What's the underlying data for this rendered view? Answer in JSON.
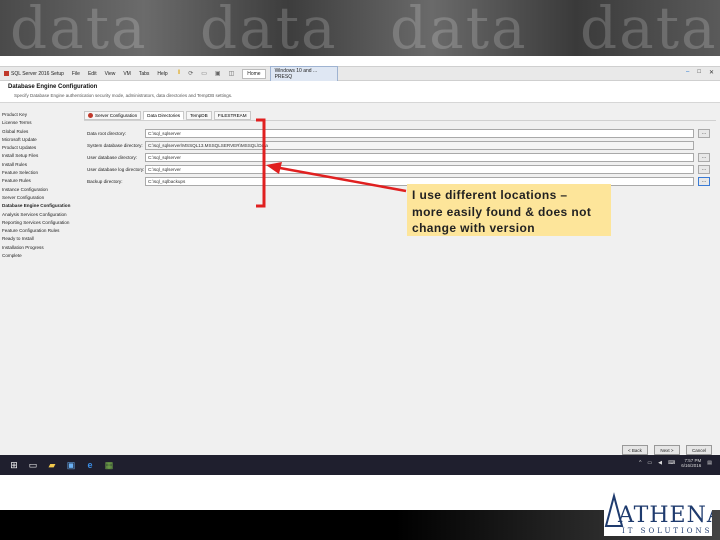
{
  "banner": {
    "words": [
      "data",
      "data",
      "data",
      "data"
    ]
  },
  "window": {
    "app_title": "SQL Server 2016 Setup",
    "menu": [
      "File",
      "Edit",
      "View",
      "VM",
      "Tabs",
      "Help"
    ],
    "tab_home": "Home",
    "tab_vm": "Windows 10 and ... PRESQ",
    "header_title": "Database Engine Configuration",
    "header_subtitle": "Specify Database Engine authentication security mode, administrators, data directories and TempDB settings."
  },
  "nav_items": [
    "Product Key",
    "License Terms",
    "Global Rules",
    "Microsoft Update",
    "Product Updates",
    "Install Setup Files",
    "Install Rules",
    "Feature Selection",
    "Feature Rules",
    "Instance Configuration",
    "Server Configuration",
    "Database Engine Configuration",
    "Analysis Services Configuration",
    "Reporting Services Configuration",
    "Feature Configuration Rules",
    "Ready to Install",
    "Installation Progress",
    "Complete"
  ],
  "tabs": [
    "Server Configuration",
    "Data Directories",
    "TempDB",
    "FILESTREAM"
  ],
  "fields": [
    {
      "label": "Data root directory:",
      "value": "C:\\sql_sqlserver"
    },
    {
      "label": "System database directory:",
      "value": "C:\\sql_sqlserver\\MSSQL13.MSSQLSERVER\\MSSQL\\Data"
    },
    {
      "label": "User database directory:",
      "value": "C:\\sql_sqlserver"
    },
    {
      "label": "User database log directory:",
      "value": "C:\\sql_sqlserver"
    },
    {
      "label": "Backup directory:",
      "value": "C:\\sql_sqlbackups"
    }
  ],
  "footer_buttons": [
    "< Back",
    "Next >",
    "Cancel"
  ],
  "taskbar": {
    "time": "7:57 PM",
    "date": "6/16/2016"
  },
  "annotation": {
    "line1": "I use different locations –",
    "line2": "more easily found & does not",
    "line3": "change with version"
  },
  "logo": {
    "name": "ATHENA",
    "tagline": "IT SOLUTIONS"
  },
  "colors": {
    "annotation_bg": "#fde59a",
    "accent": "#e02020"
  }
}
